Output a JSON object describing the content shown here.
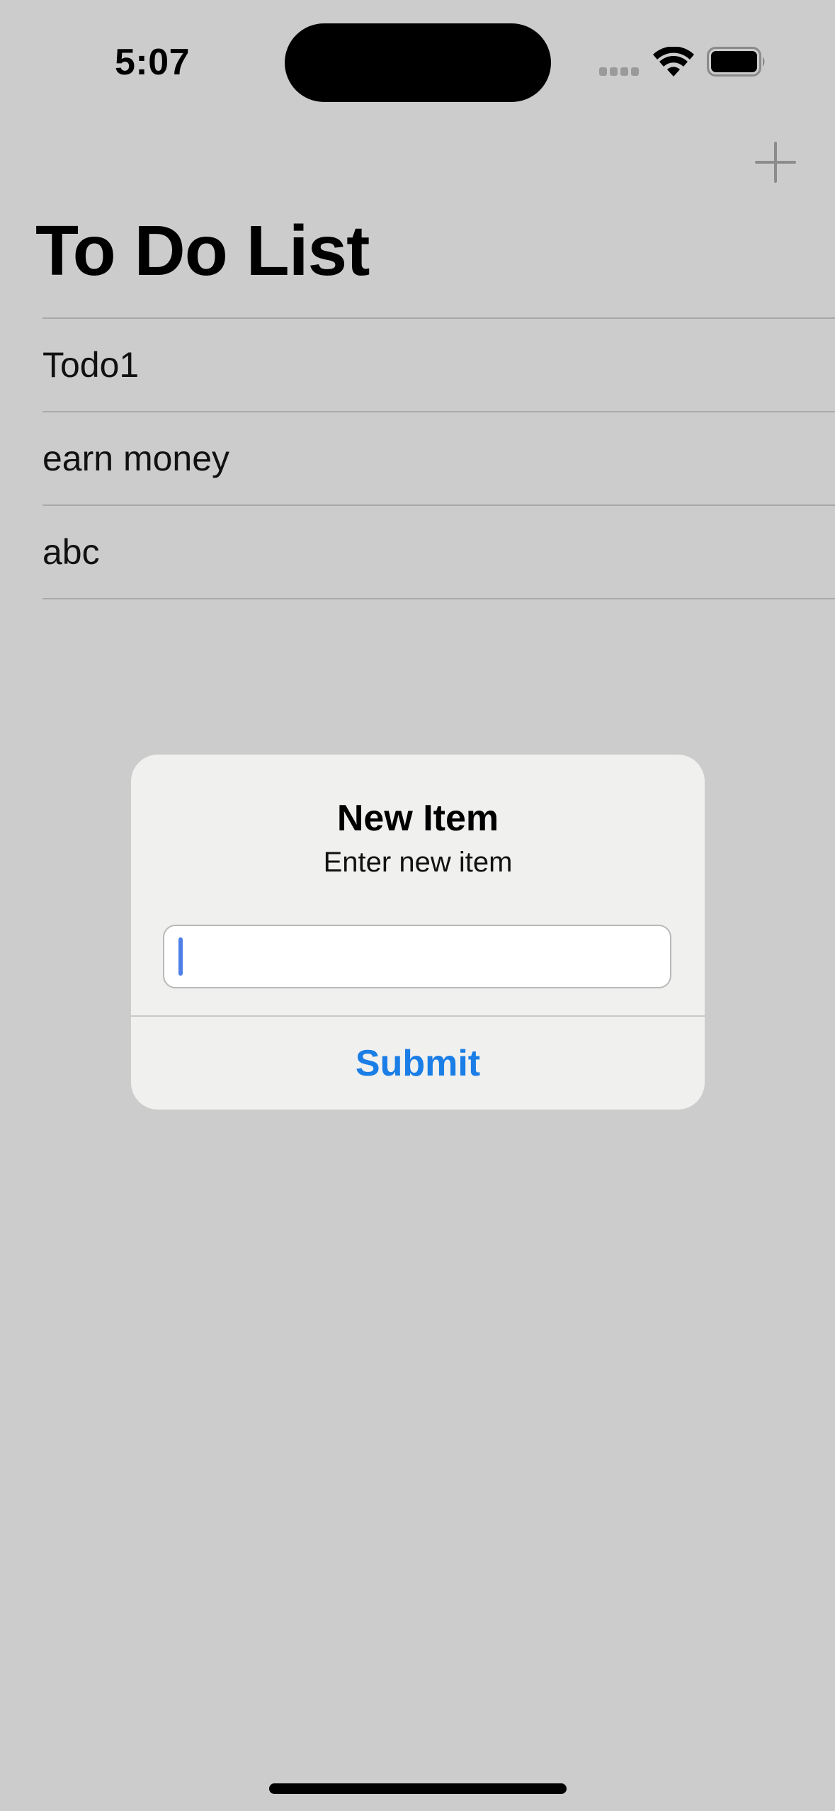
{
  "status_bar": {
    "time": "5:07",
    "icons": [
      "cellular-signal-icon",
      "wifi-icon",
      "battery-icon"
    ]
  },
  "nav": {
    "title": "To Do List",
    "add_icon": "plus-icon"
  },
  "todo_items": [
    {
      "label": "Todo1"
    },
    {
      "label": "earn money"
    },
    {
      "label": "abc"
    }
  ],
  "alert": {
    "title": "New Item",
    "message": "Enter new item",
    "input_value": "",
    "input_placeholder": "",
    "submit_label": "Submit"
  },
  "colors": {
    "background": "#cccccc",
    "alert_background": "#f0f0ef",
    "accent": "#1a7ee6"
  }
}
